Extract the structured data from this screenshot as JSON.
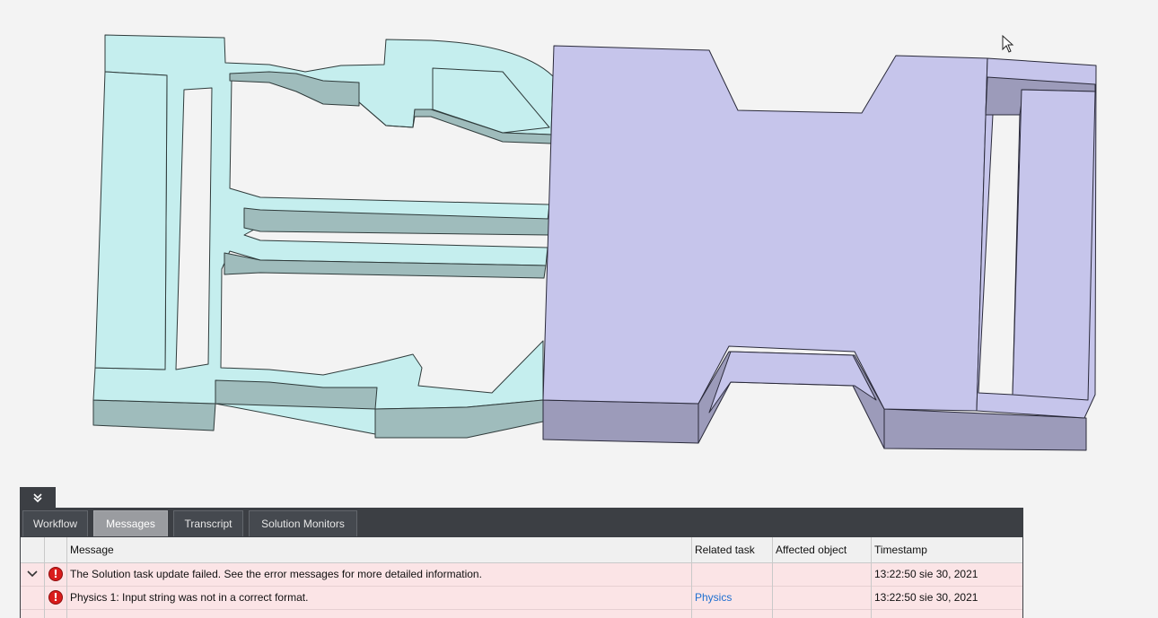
{
  "colors": {
    "part_left_top": "#c5eeee",
    "part_left_side": "#9fbcbc",
    "part_right_top": "#c6c5eb",
    "part_right_side": "#9c9bba",
    "background": "#f3f3f3",
    "error_row": "#fbe4e6",
    "link": "#1e6fd0"
  },
  "icons": {
    "collapse": "double-chevron-down-icon",
    "error": "error-circle-icon",
    "expander": "chevron-down-icon",
    "cursor": "mouse-pointer-icon"
  },
  "tabs": [
    {
      "label": "Workflow"
    },
    {
      "label": "Messages"
    },
    {
      "label": "Transcript"
    },
    {
      "label": "Solution Monitors"
    }
  ],
  "active_tab": "Messages",
  "table": {
    "headers": {
      "message": "Message",
      "related_task": "Related task",
      "affected_object": "Affected object",
      "timestamp": "Timestamp"
    },
    "rows": [
      {
        "type": "error",
        "message": "The Solution task update failed. See the error messages for more detailed information.",
        "related_task": "",
        "affected_object": "",
        "timestamp": "13:22:50 sie 30, 2021"
      },
      {
        "type": "error",
        "message": "Physics 1: Input string was not in a correct format.",
        "related_task": "Physics",
        "affected_object": "",
        "timestamp": "13:22:50 sie 30, 2021"
      }
    ]
  }
}
